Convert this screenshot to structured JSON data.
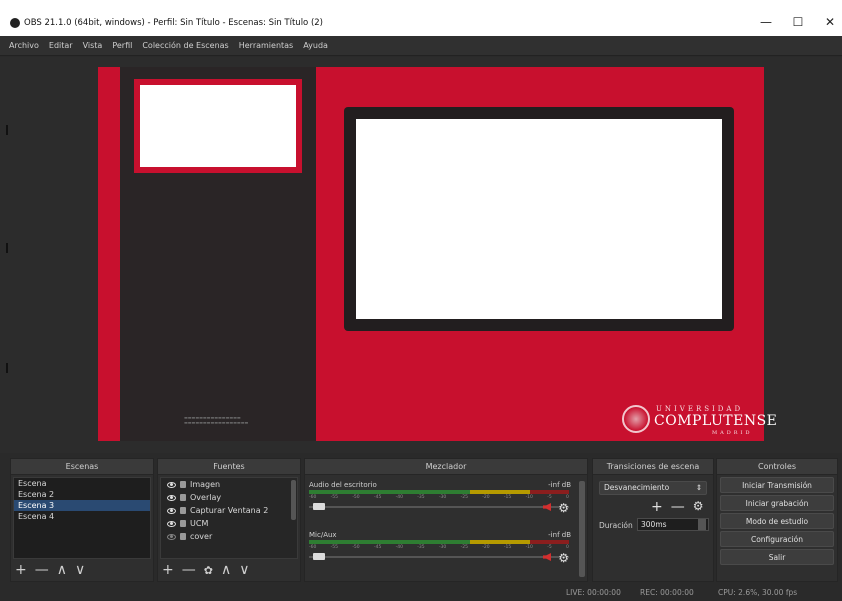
{
  "window": {
    "title": "OBS 21.1.0 (64bit, windows) - Perfil: Sin Título - Escenas: Sin Título (2)",
    "minimize_glyph": "—",
    "maximize_glyph": "☐",
    "close_glyph": "✕"
  },
  "menu": [
    "Archivo",
    "Editar",
    "Vista",
    "Perfil",
    "Colección de Escenas",
    "Herramientas",
    "Ayuda"
  ],
  "preview": {
    "canvas_color": "#c8102e",
    "logo": {
      "top": "UNIVERSIDAD",
      "main": "COMPLUTENSE",
      "bottom": "MADRID"
    }
  },
  "scenes": {
    "title": "Escenas",
    "items": [
      "Escena",
      "Escena 2",
      "Escena 3",
      "Escena 4"
    ],
    "selected_index": 2,
    "add_glyph": "+",
    "remove_glyph": "—",
    "up_glyph": "∧",
    "down_glyph": "∨"
  },
  "sources": {
    "title": "Fuentes",
    "items": [
      "Imagen",
      "Overlay",
      "Capturar Ventana 2",
      "UCM",
      "cover"
    ],
    "add_glyph": "+",
    "remove_glyph": "—",
    "gear_glyph": "✿",
    "up_glyph": "∧",
    "down_glyph": "∨"
  },
  "mixer": {
    "title": "Mezclador",
    "channels": [
      {
        "name": "Audio del escritorio",
        "db": "-inf dB",
        "muted": true
      },
      {
        "name": "Mic/Aux",
        "db": "-inf dB",
        "muted": true
      }
    ],
    "ticks": [
      "-60",
      "-55",
      "-50",
      "-45",
      "-40",
      "-35",
      "-30",
      "-25",
      "-20",
      "-15",
      "-10",
      "-5",
      "0"
    ]
  },
  "transitions": {
    "title": "Transiciones de escena",
    "selected": "Desvanecimiento",
    "add_glyph": "+",
    "remove_glyph": "—",
    "gear_glyph": "✿",
    "duration_label": "Duración",
    "duration_value": "300ms"
  },
  "controls": {
    "title": "Controles",
    "buttons": [
      "Iniciar Transmisión",
      "Iniciar grabación",
      "Modo de estudio",
      "Configuración",
      "Salir"
    ]
  },
  "status": {
    "live": "LIVE: 00:00:00",
    "rec": "REC: 00:00:00",
    "cpu": "CPU: 2.6%, 30.00 fps"
  }
}
